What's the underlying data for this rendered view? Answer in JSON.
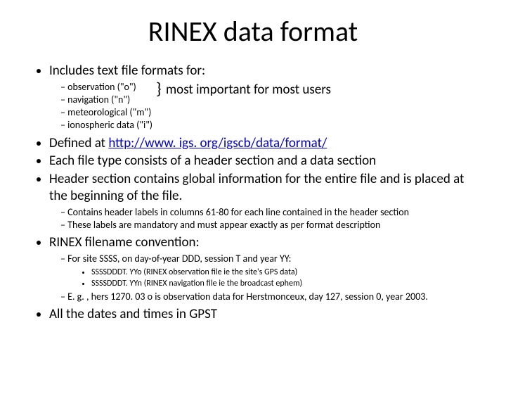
{
  "title": "RINEX data format",
  "bullets": {
    "b1": "Includes text file formats for:",
    "b1_sub": {
      "s1": "observation (\"o\")",
      "s2": "navigation (\"n\")",
      "s3": "meteorological (\"m\")",
      "s4": "ionospheric data (\"i\")",
      "brace_note": "most important for most users"
    },
    "b2_pre": "Defined at ",
    "b2_link": "http://www. igs. org/igscb/data/format/",
    "b3": "Each file type consists of a header section and a data section",
    "b4": "Header section contains global information for the entire file and is placed at the beginning of the file.",
    "b4_sub": {
      "s1": "Contains header labels in columns 61-80 for each line contained in the header section",
      "s2": "These labels are mandatory and must appear exactly as per format description"
    },
    "b5": "RINEX filename convention:",
    "b5_sub": {
      "s1": "For site SSSS, on day-of-year DDD, session T and year YY:",
      "s1_sub": {
        "a": "SSSSDDDT. YYo (RINEX observation file ie the site's GPS data)",
        "b": "SSSSDDDT. YYn (RINEX navigation file ie the broadcast ephem)"
      },
      "s2": "E. g. , hers 1270. 03 o is observation data for Herstmonceux, day 127, session 0, year 2003."
    },
    "b6": "All the dates and times in GPST"
  }
}
